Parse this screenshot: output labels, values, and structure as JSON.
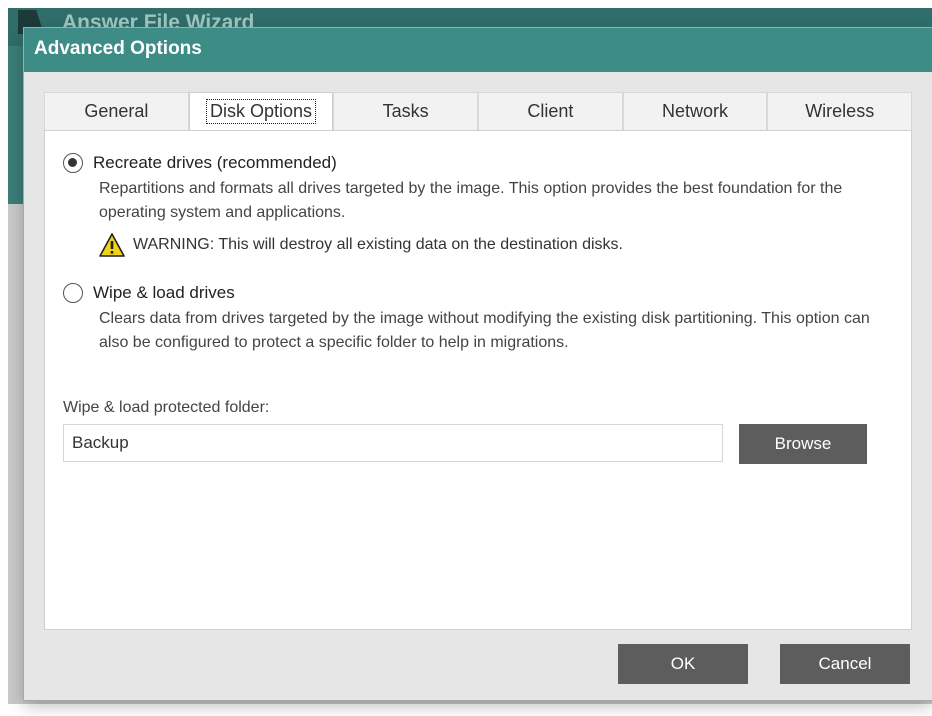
{
  "background_window": {
    "title": "Answer File Wizard",
    "icon": "app-icon"
  },
  "dialog": {
    "title": "Advanced Options",
    "tabs": [
      {
        "label": "General",
        "active": false
      },
      {
        "label": "Disk Options",
        "active": true
      },
      {
        "label": "Tasks",
        "active": false
      },
      {
        "label": "Client",
        "active": false
      },
      {
        "label": "Network",
        "active": false
      },
      {
        "label": "Wireless",
        "active": false
      }
    ],
    "disk_options": {
      "recreate": {
        "label": "Recreate drives (recommended)",
        "selected": true,
        "description": "Repartitions and formats all drives targeted by the image. This option provides the best foundation for the operating system and applications.",
        "warning_icon": "warning-icon",
        "warning": "WARNING: This will destroy all existing data on the destination disks."
      },
      "wipe_load": {
        "label": "Wipe & load drives",
        "selected": false,
        "description": "Clears data from drives targeted by the image without modifying the existing disk partitioning. This option can also be configured to protect a specific folder to help in migrations."
      },
      "protected_folder": {
        "label": "Wipe & load protected folder:",
        "value": "Backup",
        "browse_label": "Browse"
      }
    },
    "ok_label": "OK",
    "cancel_label": "Cancel"
  },
  "colors": {
    "dialog_titlebar": "#3e8c86",
    "background_titlebar": "#2f6e6a",
    "button": "#5d5d5d",
    "warning": "#f2d21b"
  }
}
